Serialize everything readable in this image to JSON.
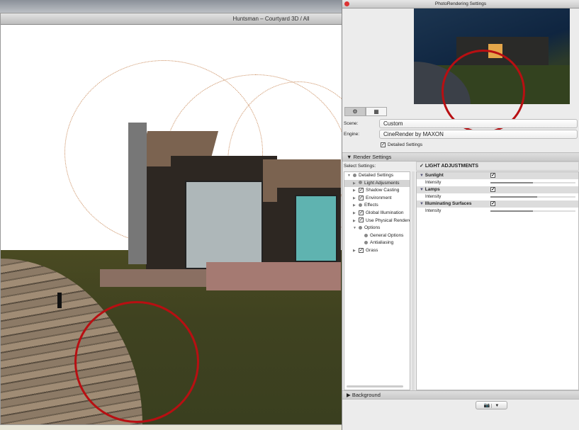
{
  "viewport": {
    "title": "Huntsman – Courtyard 3D / All"
  },
  "palette": {
    "title": "PhotoRendering Settings",
    "tabs": [
      {
        "icon": "gear-icon",
        "glyph": "⚙"
      },
      {
        "icon": "layout-icon",
        "glyph": "▦"
      }
    ],
    "scene_label": "Scene:",
    "scene_value": "Custom",
    "engine_label": "Engine:",
    "engine_value": "CineRender by MAXON",
    "detailed_settings": "Detailed Settings",
    "render_settings": "Render Settings",
    "select_settings": "Select Settings:",
    "section_title": "LIGHT ADJUSTMENTS",
    "tree": [
      {
        "label": "Detailed Settings",
        "arrow": "▼",
        "mark": "dot"
      },
      {
        "label": "Light Adjusments",
        "arrow": "▶",
        "mark": "dot",
        "selected": true
      },
      {
        "label": "Shadow Casting",
        "arrow": "▶",
        "mark": "check"
      },
      {
        "label": "Environment",
        "arrow": "▶",
        "mark": "check"
      },
      {
        "label": "Effects",
        "arrow": "▶",
        "mark": "dot"
      },
      {
        "label": "Global Illumination",
        "arrow": "▶",
        "mark": "check"
      },
      {
        "label": "Use Physical Renderer",
        "arrow": "▶",
        "mark": "check"
      },
      {
        "label": "Options",
        "arrow": "▼",
        "mark": "dot"
      },
      {
        "label": "General Options",
        "arrow": "",
        "mark": "dot"
      },
      {
        "label": "Antialiasing",
        "arrow": "",
        "mark": "dot"
      },
      {
        "label": "Grass",
        "arrow": "▶",
        "mark": "check"
      }
    ],
    "groups": [
      {
        "name": "Sunlight",
        "checked": true,
        "param": "Intensity",
        "value": 0.5
      },
      {
        "name": "Lamps",
        "checked": true,
        "param": "Intensity",
        "value": 0.55
      },
      {
        "name": "Illuminating Surfaces",
        "checked": true,
        "param": "Intensity",
        "value": 0.5
      }
    ],
    "background": "Background",
    "render_button": {
      "icon": "camera-icon",
      "glyph": "📷",
      "menu": "▼"
    }
  }
}
